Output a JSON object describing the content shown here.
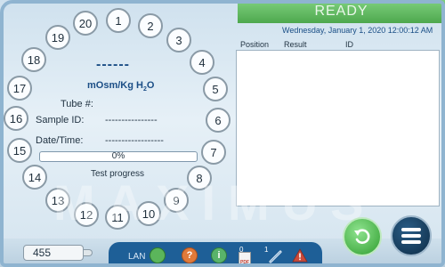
{
  "carousel": {
    "positions": [
      "1",
      "2",
      "3",
      "4",
      "5",
      "6",
      "7",
      "8",
      "9",
      "10",
      "11",
      "12",
      "13",
      "14",
      "15",
      "16",
      "17",
      "18",
      "19",
      "20"
    ]
  },
  "measurement": {
    "value_display": "------",
    "unit_prefix": "mOsm/Kg H",
    "unit_subscript": "2",
    "unit_suffix": "O",
    "tube_label": "Tube #:",
    "tube_value": "",
    "sample_id_label": "Sample ID:",
    "sample_id_value": "----------------",
    "datetime_label": "Date/Time:",
    "datetime_value": "------------------",
    "progress_text": "0%",
    "progress_fraction": 0,
    "progress_label": "Test progress"
  },
  "status": {
    "text": "READY",
    "color": "#5bb55b"
  },
  "clock": {
    "datetime": "Wednesday, January 1, 2020 12:00:12 AM"
  },
  "results": {
    "columns": [
      "Position",
      "Result",
      "ID"
    ],
    "rows": []
  },
  "watermark": "MAXIMUS",
  "bottom_bar": {
    "counter_value": "455",
    "lan_label": "LAN",
    "lan_status_color": "#5bb55b",
    "help_icon": "question-icon",
    "info_icon": "info-icon",
    "pdf_count": "0",
    "pdf_label": "PDF",
    "pipette_count": "1",
    "warning_icon": "warning-icon",
    "start_icon": "restart-icon",
    "menu_icon": "hamburger-menu-icon"
  }
}
